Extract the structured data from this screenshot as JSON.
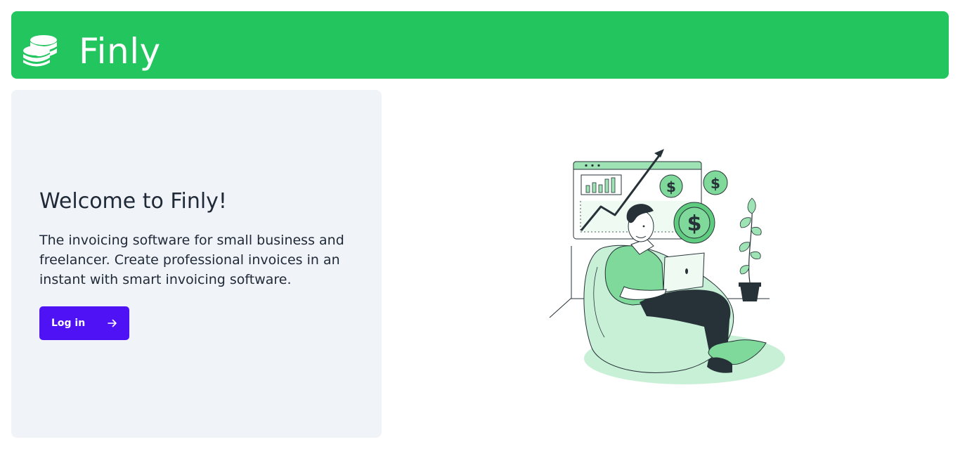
{
  "header": {
    "brand": "Finly",
    "logo_icon": "coins-stack-icon",
    "background_color": "#22c55e"
  },
  "hero": {
    "title": "Welcome to Finly!",
    "description": "The invoicing software for small business and freelancer. Create professional invoices in an instant with smart invoicing software.",
    "login_button": {
      "label": "Log in",
      "icon": "arrow-right-icon",
      "color": "#4f12f5"
    }
  },
  "illustration": {
    "icon": "finance-illustration",
    "currency_symbol": "$"
  }
}
